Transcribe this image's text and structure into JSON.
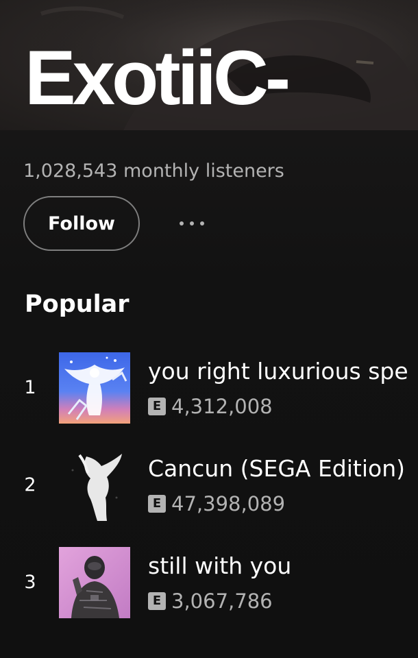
{
  "artist": {
    "name": "ExotiiC-",
    "monthly_listeners": "1,028,543 monthly listeners"
  },
  "actions": {
    "follow_label": "Follow",
    "more_icon": "more-options-icon"
  },
  "popular": {
    "title": "Popular",
    "tracks": [
      {
        "rank": "1",
        "title": "you right luxurious spe",
        "explicit": "E",
        "plays": "4,312,008",
        "cover": "angel-chains-cover"
      },
      {
        "rank": "2",
        "title": "Cancun (SEGA Edition)",
        "explicit": "E",
        "plays": "47,398,089",
        "cover": "white-angel-statue-cover"
      },
      {
        "rank": "3",
        "title": "still with you",
        "explicit": "E",
        "plays": "3,067,786",
        "cover": "masked-figure-pink-cover"
      }
    ]
  },
  "colors": {
    "background": "#121212",
    "text_primary": "#ffffff",
    "text_secondary": "#b3b3b3"
  }
}
